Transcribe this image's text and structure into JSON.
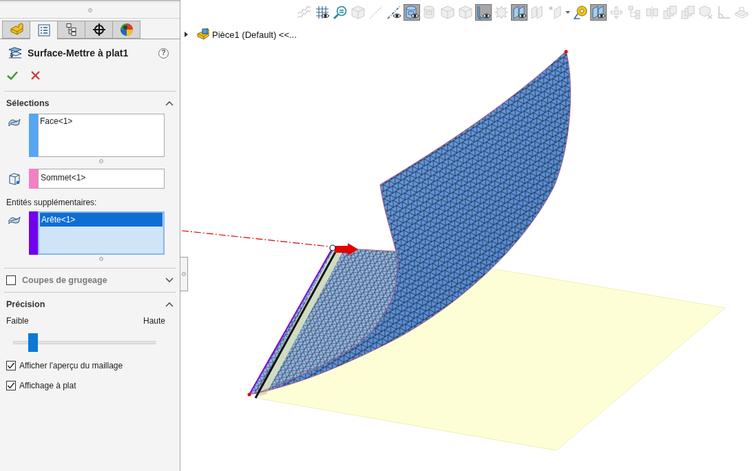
{
  "property_manager": {
    "tabs": [
      {
        "kind": "feature-tree",
        "selected": false
      },
      {
        "kind": "property",
        "selected": true
      },
      {
        "kind": "configuration",
        "selected": false
      },
      {
        "kind": "dimxpert",
        "selected": false
      },
      {
        "kind": "display",
        "selected": false
      }
    ],
    "title": "Surface-Mettre à plat1",
    "help": "?",
    "actions": [
      {
        "kind": "ok"
      },
      {
        "kind": "cancel"
      }
    ],
    "sections": [
      {
        "kind": "group",
        "title": "Sélections",
        "expanded": true,
        "rows": [
          {
            "kind": "listbox",
            "color": "#55a6f5",
            "focused": false,
            "items": [
              {
                "text": "Face<1>",
                "selected": false
              }
            ]
          },
          {
            "kind": "textbox",
            "color": "#f47fc4",
            "value": "Sommet<1>"
          },
          {
            "kind": "label",
            "text": "Entités supplémentaires:"
          },
          {
            "kind": "listbox",
            "color": "#7000ee",
            "focused": true,
            "items": [
              {
                "text": "Arête<1>",
                "selected": true
              }
            ]
          }
        ]
      },
      {
        "kind": "check-group",
        "title": "Coupes de grugeage",
        "checked": false,
        "expanded": false
      },
      {
        "kind": "group",
        "title": "Précision",
        "expanded": true,
        "rows": [
          {
            "kind": "slider",
            "min_label": "Faible",
            "max_label": "Haute",
            "level": 0.11
          },
          {
            "kind": "checkbox",
            "text": "Afficher l'aperçu du maillage",
            "checked": true
          },
          {
            "kind": "checkbox",
            "text": "Affichage à plat",
            "checked": true
          }
        ]
      }
    ]
  },
  "viewport": {
    "toolbar": [
      {
        "kind": "hatch",
        "pressed": false,
        "disabled": true
      },
      {
        "kind": "grid",
        "pressed": false,
        "disabled": false
      },
      {
        "kind": "magnifier",
        "pressed": false,
        "disabled": false
      },
      {
        "kind": "cube",
        "pressed": false,
        "disabled": true
      },
      {
        "kind": "dashed-line",
        "pressed": false,
        "disabled": true
      },
      {
        "kind": "axis",
        "pressed": false,
        "disabled": false
      },
      {
        "kind": "cylinder",
        "pressed": true,
        "disabled": false
      },
      {
        "kind": "cylinder",
        "pressed": false,
        "disabled": true
      },
      {
        "kind": "cube",
        "pressed": false,
        "disabled": true
      },
      {
        "kind": "cube",
        "pressed": false,
        "disabled": true
      },
      {
        "kind": "bracket",
        "pressed": true,
        "disabled": false
      },
      {
        "kind": "gear",
        "pressed": false,
        "disabled": true
      },
      {
        "kind": "plane",
        "pressed": true,
        "disabled": false
      },
      {
        "kind": "plane",
        "pressed": false,
        "disabled": true
      },
      {
        "kind": "point-plane",
        "pressed": false,
        "disabled": true,
        "dropdown": true
      },
      {
        "kind": "tape",
        "pressed": false,
        "disabled": false
      },
      {
        "kind": "plane",
        "pressed": true,
        "disabled": false
      },
      {
        "kind": "arrows",
        "pressed": false,
        "disabled": true
      },
      {
        "kind": "tree",
        "pressed": false,
        "disabled": true
      },
      {
        "kind": "mirror",
        "pressed": false,
        "disabled": true
      },
      {
        "kind": "stack",
        "pressed": false,
        "disabled": true
      },
      {
        "kind": "stack",
        "pressed": false,
        "disabled": true
      },
      {
        "kind": "cube-x",
        "pressed": false,
        "disabled": true
      },
      {
        "kind": "corner",
        "pressed": false,
        "disabled": true
      },
      {
        "kind": "tray",
        "pressed": false,
        "disabled": true
      }
    ],
    "tree": {
      "label": "Pièce1 (Default) <<...",
      "expanded": false
    }
  }
}
